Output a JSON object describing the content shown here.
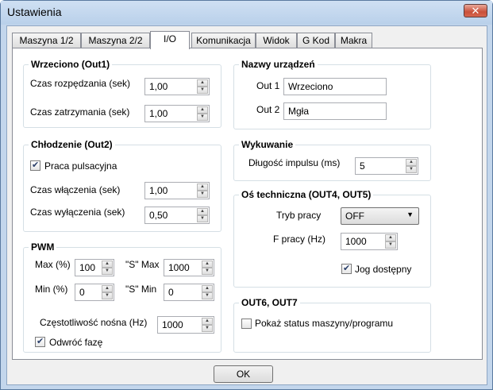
{
  "window": {
    "title": "Ustawienia",
    "close_label": "✕"
  },
  "tabs": [
    {
      "label": "Maszyna 1/2"
    },
    {
      "label": "Maszyna 2/2"
    },
    {
      "label": "I/O"
    },
    {
      "label": "Komunikacja"
    },
    {
      "label": "Widok"
    },
    {
      "label": "G Kod"
    },
    {
      "label": "Makra"
    }
  ],
  "wrzeciono": {
    "title": "Wrzeciono (Out1)",
    "rozp_label": "Czas rozpędzania (sek)",
    "rozp_value": "1,00",
    "zatrz_label": "Czas zatrzymania (sek)",
    "zatrz_value": "1,00"
  },
  "chlodzenie": {
    "title": "Chłodzenie (Out2)",
    "pulsacyjna_label": "Praca pulsacyjna",
    "wl_label": "Czas włączenia (sek)",
    "wl_value": "1,00",
    "wyl_label": "Czas wyłączenia (sek)",
    "wyl_value": "0,50"
  },
  "pwm": {
    "title": "PWM",
    "max_label": "Max (%)",
    "max_value": "100",
    "smax_label": "\"S\" Max",
    "smax_value": "1000",
    "min_label": "Min (%)",
    "min_value": "0",
    "smin_label": "\"S\" Min",
    "smin_value": "0",
    "freq_label": "Częstotliwość nośna (Hz)",
    "freq_value": "1000",
    "invert_label": "Odwróć fazę"
  },
  "nazwy": {
    "title": "Nazwy urządzeń",
    "out1_label": "Out 1",
    "out1_value": "Wrzeciono",
    "out2_label": "Out 2",
    "out2_value": "Mgła"
  },
  "wykuwanie": {
    "title": "Wykuwanie",
    "impuls_label": "Długość impulsu (ms)",
    "impuls_value": "5"
  },
  "os": {
    "title": "Oś techniczna (OUT4, OUT5)",
    "tryb_label": "Tryb pracy",
    "tryb_value": "OFF",
    "f_label": "F pracy (Hz)",
    "f_value": "1000",
    "jog_label": "Jog dostępny"
  },
  "out67": {
    "title": "OUT6, OUT7",
    "status_label": "Pokaż status maszyny/programu"
  },
  "buttons": {
    "ok": "OK"
  }
}
